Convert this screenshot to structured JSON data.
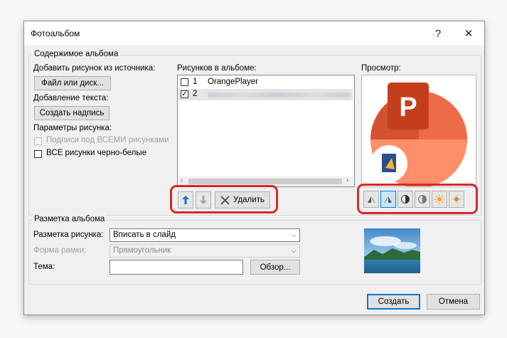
{
  "window": {
    "title": "Фотоальбом",
    "help": "?",
    "close": "✕"
  },
  "content_group": {
    "label": "Содержимое альбома",
    "add_picture_from": "Добавить рисунок из источника:",
    "file_or_disk_button": "Файл или диск...",
    "add_text_label": "Добавление текста:",
    "new_text_box_button": "Создать надпись",
    "picture_options_label": "Параметры рисунка:",
    "captions_below_all": "Подписи под ВСЕМИ рисунками",
    "all_black_and_white": "ВСЕ рисунки черно-белые"
  },
  "album_list": {
    "label": "Рисунков в альбоме:",
    "items": [
      {
        "index": "1",
        "name": "OrangePlayer",
        "checked": false
      },
      {
        "index": "2",
        "name": "",
        "checked": true
      }
    ],
    "move_up_icon": "arrow-up-icon",
    "move_down_icon": "arrow-down-icon",
    "remove_button": "Удалить"
  },
  "preview": {
    "label": "Просмотр:",
    "tools": [
      "rotate-left-icon",
      "rotate-right-icon",
      "contrast-up-icon",
      "contrast-down-icon",
      "brightness-up-icon",
      "brightness-down-icon"
    ]
  },
  "layout_group": {
    "label": "Разметка альбома",
    "picture_layout_label": "Разметка рисунка:",
    "picture_layout_value": "Вписать в слайд",
    "frame_shape_label": "Форма рамки:",
    "frame_shape_value": "Прямоугольник",
    "theme_label": "Тема:",
    "theme_value": "",
    "browse_button": "Обзор..."
  },
  "footer": {
    "create_button": "Создать",
    "cancel_button": "Отмена"
  },
  "colors": {
    "highlight_red": "#d62828",
    "accent_blue": "#0078d7",
    "ppt_orange": "#d35230"
  }
}
